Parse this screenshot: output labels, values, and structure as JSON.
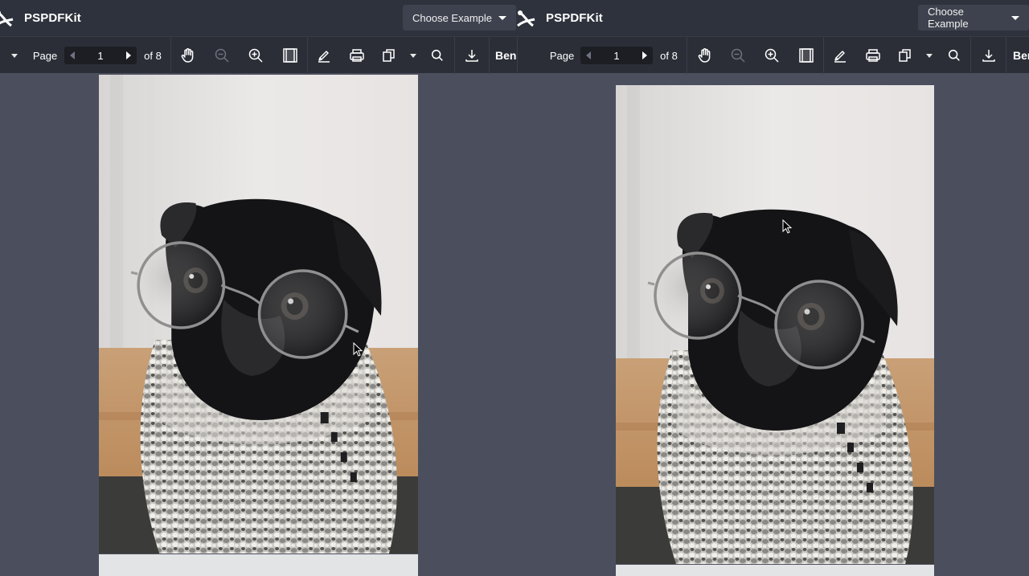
{
  "left": {
    "brand": "PSPDFKit",
    "choose_example": "Choose Example",
    "toolbar": {
      "page_label": "Page",
      "page_value": "1",
      "page_total": "of 8",
      "user": "Ben"
    }
  },
  "right": {
    "brand": "PSPDFKit",
    "choose_example": "Choose Example",
    "toolbar": {
      "page_label": "Page",
      "page_value": "1",
      "page_total": "of 8",
      "user": "Ben"
    }
  },
  "colors": {
    "header_bg": "#2e323c",
    "toolbar_bg": "#2b2e37",
    "canvas_bg": "#4b4f5d",
    "dropdown_bg": "#3e424e"
  },
  "icons": [
    "pspdfkit-logo-icon",
    "hand-tool-icon",
    "zoom-out-icon",
    "zoom-in-icon",
    "page-layout-icon",
    "pen-icon",
    "print-icon",
    "document-editor-icon",
    "search-icon",
    "download-icon"
  ],
  "document": {
    "content": "photo-of-pug-wearing-round-glasses-and-knit-sweater"
  }
}
